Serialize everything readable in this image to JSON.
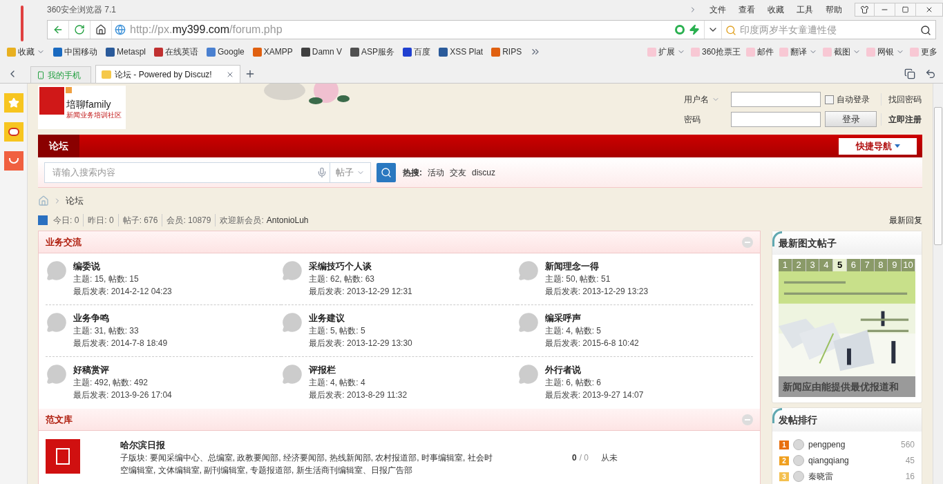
{
  "browser": {
    "title": "360安全浏览器 7.1",
    "menu": [
      "文件",
      "查看",
      "收藏",
      "工具",
      "帮助"
    ],
    "address": {
      "prefix": "http://px.",
      "domain": "my399.com",
      "suffix": "/forum.php"
    },
    "search": {
      "placeholder": "印度两岁半女童遭性侵"
    },
    "bookmarks": [
      {
        "label": "收藏",
        "has_menu": true
      },
      {
        "label": "中国移动",
        "has_menu": false
      },
      {
        "label": "Metaspl",
        "has_menu": false
      },
      {
        "label": "在线英语",
        "has_menu": false
      },
      {
        "label": "Google",
        "has_menu": false
      },
      {
        "label": "XAMPP",
        "has_menu": false
      },
      {
        "label": "Damn V",
        "has_menu": false
      },
      {
        "label": "ASP服务",
        "has_menu": false
      },
      {
        "label": "百度",
        "has_menu": false
      },
      {
        "label": "XSS Plat",
        "has_menu": false
      },
      {
        "label": "RIPS",
        "has_menu": false
      }
    ],
    "extensions": [
      {
        "label": "扩展",
        "has_menu": true
      },
      {
        "label": "360抢票王",
        "has_menu": false
      },
      {
        "label": "邮件",
        "has_menu": false
      },
      {
        "label": "翻译",
        "has_menu": true
      },
      {
        "label": "截图",
        "has_menu": true
      },
      {
        "label": "网银",
        "has_menu": true
      },
      {
        "label": "更多",
        "has_menu": false
      }
    ],
    "tabs": [
      {
        "label": "我的手机",
        "kind": "phone",
        "selected": false
      },
      {
        "label": "论坛 - Powered by Discuz!",
        "kind": "page",
        "selected": true
      }
    ]
  },
  "page": {
    "logo": {
      "name": "培聊family",
      "tagline": "新闻业务培训社区"
    },
    "login": {
      "username_label": "用户名",
      "password_label": "密码",
      "remember": "自动登录",
      "remember_checked": false,
      "button": "登录",
      "forgot": "找回密码",
      "register": "立即注册"
    },
    "nav": {
      "items": [
        {
          "label": "论坛",
          "selected": true
        }
      ],
      "quick": "快捷导航"
    },
    "search": {
      "placeholder": "请输入搜索内容",
      "type": "帖子",
      "hot_label": "热搜:",
      "hot": [
        "活动",
        "交友",
        "discuz"
      ]
    },
    "breadcrumb": "论坛",
    "stats": [
      "今日: 0",
      "昨日: 0",
      "帖子: 676",
      "会员: 10879"
    ],
    "welcome": "欢迎新会员:",
    "newest_member": "AntonioLuh",
    "latest_reply": "最新回复",
    "sections": [
      {
        "title": "业务交流",
        "kind": "grid",
        "forums": [
          {
            "name": "编委说",
            "topics": "主题: 15, 帖数: 15",
            "last": "最后发表: 2014-2-12 04:23"
          },
          {
            "name": "采编技巧个人谈",
            "topics": "主题: 62, 帖数: 63",
            "last": "最后发表: 2013-12-29 12:31"
          },
          {
            "name": "新闻理念一得",
            "topics": "主题: 50, 帖数: 51",
            "last": "最后发表: 2013-12-29 13:23"
          },
          {
            "name": "业务争鸣",
            "topics": "主题: 31, 帖数: 33",
            "last": "最后发表: 2014-7-8 18:49"
          },
          {
            "name": "业务建议",
            "topics": "主题: 5, 帖数: 5",
            "last": "最后发表: 2013-12-29 13:30"
          },
          {
            "name": "编采呼声",
            "topics": "主题: 4, 帖数: 5",
            "last": "最后发表: 2015-6-8 10:42"
          },
          {
            "name": "好稿赏评",
            "topics": "主题: 492, 帖数: 492",
            "last": "最后发表: 2013-9-26 17:04"
          },
          {
            "name": "评报栏",
            "topics": "主题: 4, 帖数: 4",
            "last": "最后发表: 2013-8-29 11:32"
          },
          {
            "name": "外行者说",
            "topics": "主题: 6, 帖数: 6",
            "last": "最后发表: 2013-9-27 14:07"
          }
        ]
      },
      {
        "title": "范文库",
        "kind": "list",
        "forums": [
          {
            "name": "哈尔滨日报",
            "subforums": "子版块: 要闻采编中心、总编室, 政教要闻部, 经济要闻部, 热线新闻部, 农村报道部, 时事编辑室, 社会时空编辑室, 文体编辑室, 副刊编辑室, 专题报道部, 新生活商刊编辑室、日报广告部",
            "today": "0",
            "total": "/ 0",
            "last": "从未"
          }
        ]
      }
    ],
    "sidebar": {
      "gallery": {
        "title": "最新图文帖子",
        "tabs": [
          {
            "label": "1",
            "selected": false
          },
          {
            "label": "2",
            "selected": false
          },
          {
            "label": "3",
            "selected": false
          },
          {
            "label": "4",
            "selected": false
          },
          {
            "label": "5",
            "selected": true
          },
          {
            "label": "6",
            "selected": false
          },
          {
            "label": "7",
            "selected": false
          },
          {
            "label": "8",
            "selected": false
          },
          {
            "label": "9",
            "selected": false
          },
          {
            "label": "10",
            "selected": false
          }
        ],
        "caption": "新闻应由能提供最优报道和"
      },
      "ranking": {
        "title": "发帖排行",
        "users": [
          {
            "rank": "1",
            "name": "pengpeng",
            "count": "560"
          },
          {
            "rank": "2",
            "name": "qiangqiang",
            "count": "45"
          },
          {
            "rank": "3",
            "name": "秦晓雷",
            "count": "16"
          }
        ]
      }
    }
  }
}
